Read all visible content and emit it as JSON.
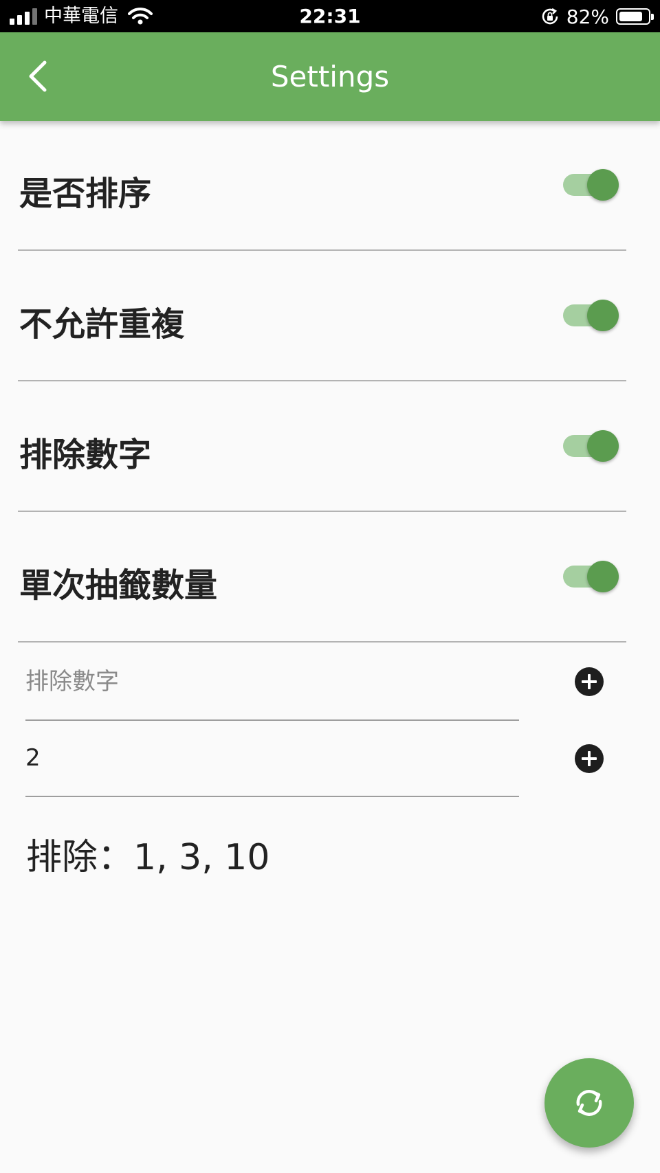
{
  "status_bar": {
    "carrier": "中華電信",
    "time": "22:31",
    "battery_percent": "82%",
    "battery_level": 0.82
  },
  "app_bar": {
    "title": "Settings",
    "back_icon": "chevron-left-icon",
    "color": "#6aae5d"
  },
  "settings": [
    {
      "label": "是否排序",
      "enabled": true
    },
    {
      "label": "不允許重複",
      "enabled": true
    },
    {
      "label": "排除數字",
      "enabled": true
    },
    {
      "label": "單次抽籤數量",
      "enabled": true
    }
  ],
  "inputs": {
    "exclude_number": {
      "placeholder": "排除數字",
      "value": ""
    },
    "draw_count": {
      "placeholder": "",
      "value": "2"
    }
  },
  "excluded_summary": "排除：1, 3, 10",
  "fab": {
    "icon": "refresh-icon"
  },
  "colors": {
    "switch_thumb": "#5b9c4f",
    "switch_track": "#a5cfa0",
    "add_button": "#1e1e1e"
  }
}
